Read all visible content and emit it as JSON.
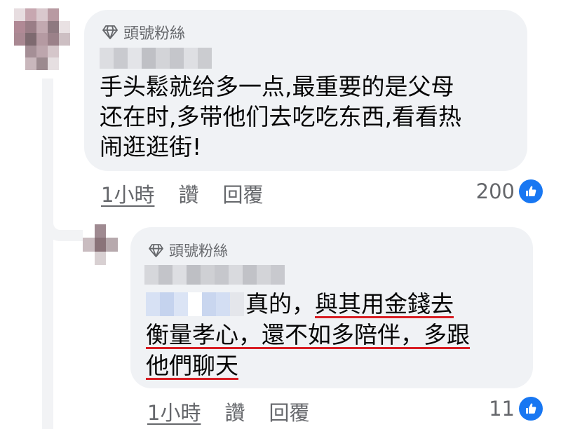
{
  "comment": {
    "badge_label": "頭號粉絲",
    "badge_icon": "diamond-icon",
    "text": "手头鬆就给多一点,最重要的是父母\n还在时,多带他们去吃吃东西,看看热\n闹逛逛街!",
    "time": "1小時",
    "like_label": "讚",
    "reply_label": "回覆",
    "reaction_count": "200",
    "reaction_icon": "like-icon"
  },
  "reply": {
    "badge_label": "頭號粉絲",
    "badge_icon": "diamond-icon",
    "text_line1_plain": "真的，",
    "text_line1_underlined": "與其用金錢去",
    "text_line2": "衡量孝心，還不如多陪伴，多跟",
    "text_line3": "他們聊天",
    "time": "1小時",
    "like_label": "讚",
    "reply_label": "回覆",
    "reaction_count": "11",
    "reaction_icon": "like-icon"
  },
  "colors": {
    "bubble": "#f0f2f5",
    "secondary_text": "#65676b",
    "like_blue": "#1877f2",
    "annotation_red": "#d81e24"
  }
}
